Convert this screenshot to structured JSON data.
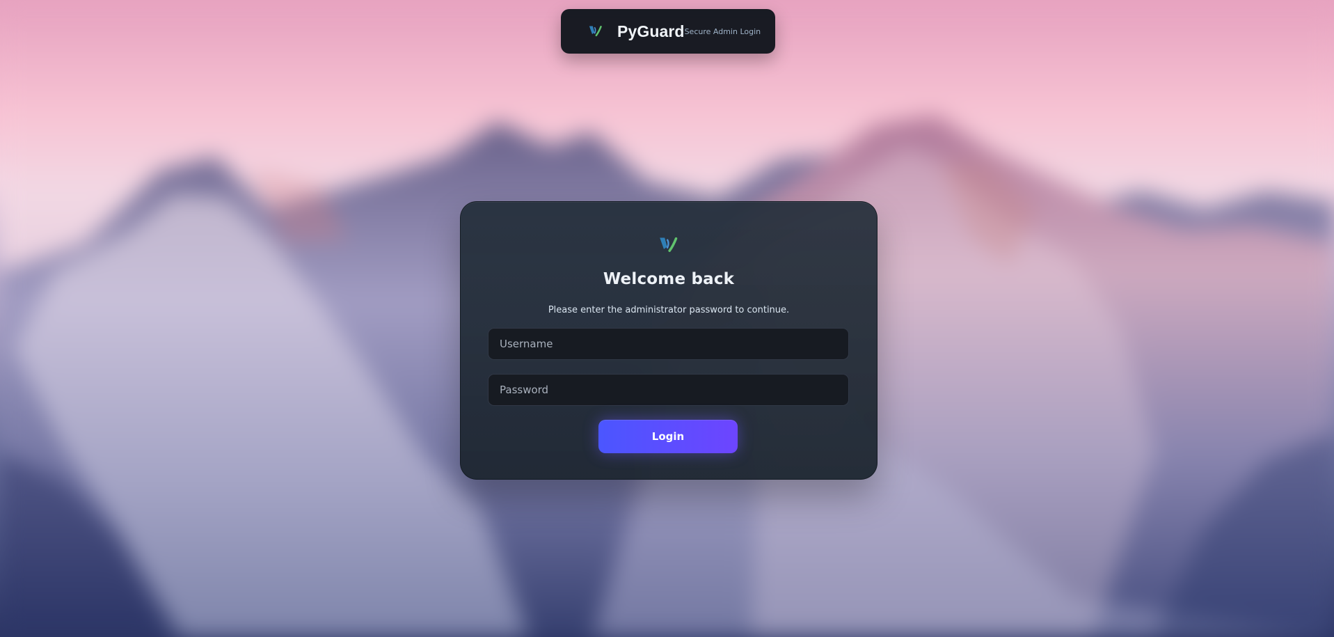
{
  "app": {
    "brand": "PyGuard",
    "subtitle": "Secure Admin Login",
    "logo_icon": "pyguard-logo-icon",
    "colors": {
      "topbar_bg": "#10151c",
      "card_bg": "#1f2934",
      "field_bg": "#171b22",
      "button_start": "#4b56ff",
      "button_end": "#6d45ff",
      "logo_blue": "#3d8dd6",
      "logo_green": "#65c476"
    }
  },
  "login": {
    "title": "Welcome back",
    "instructions": "Please enter the administrator password to continue.",
    "username_placeholder": "Username",
    "password_placeholder": "Password",
    "button_label": "Login"
  }
}
